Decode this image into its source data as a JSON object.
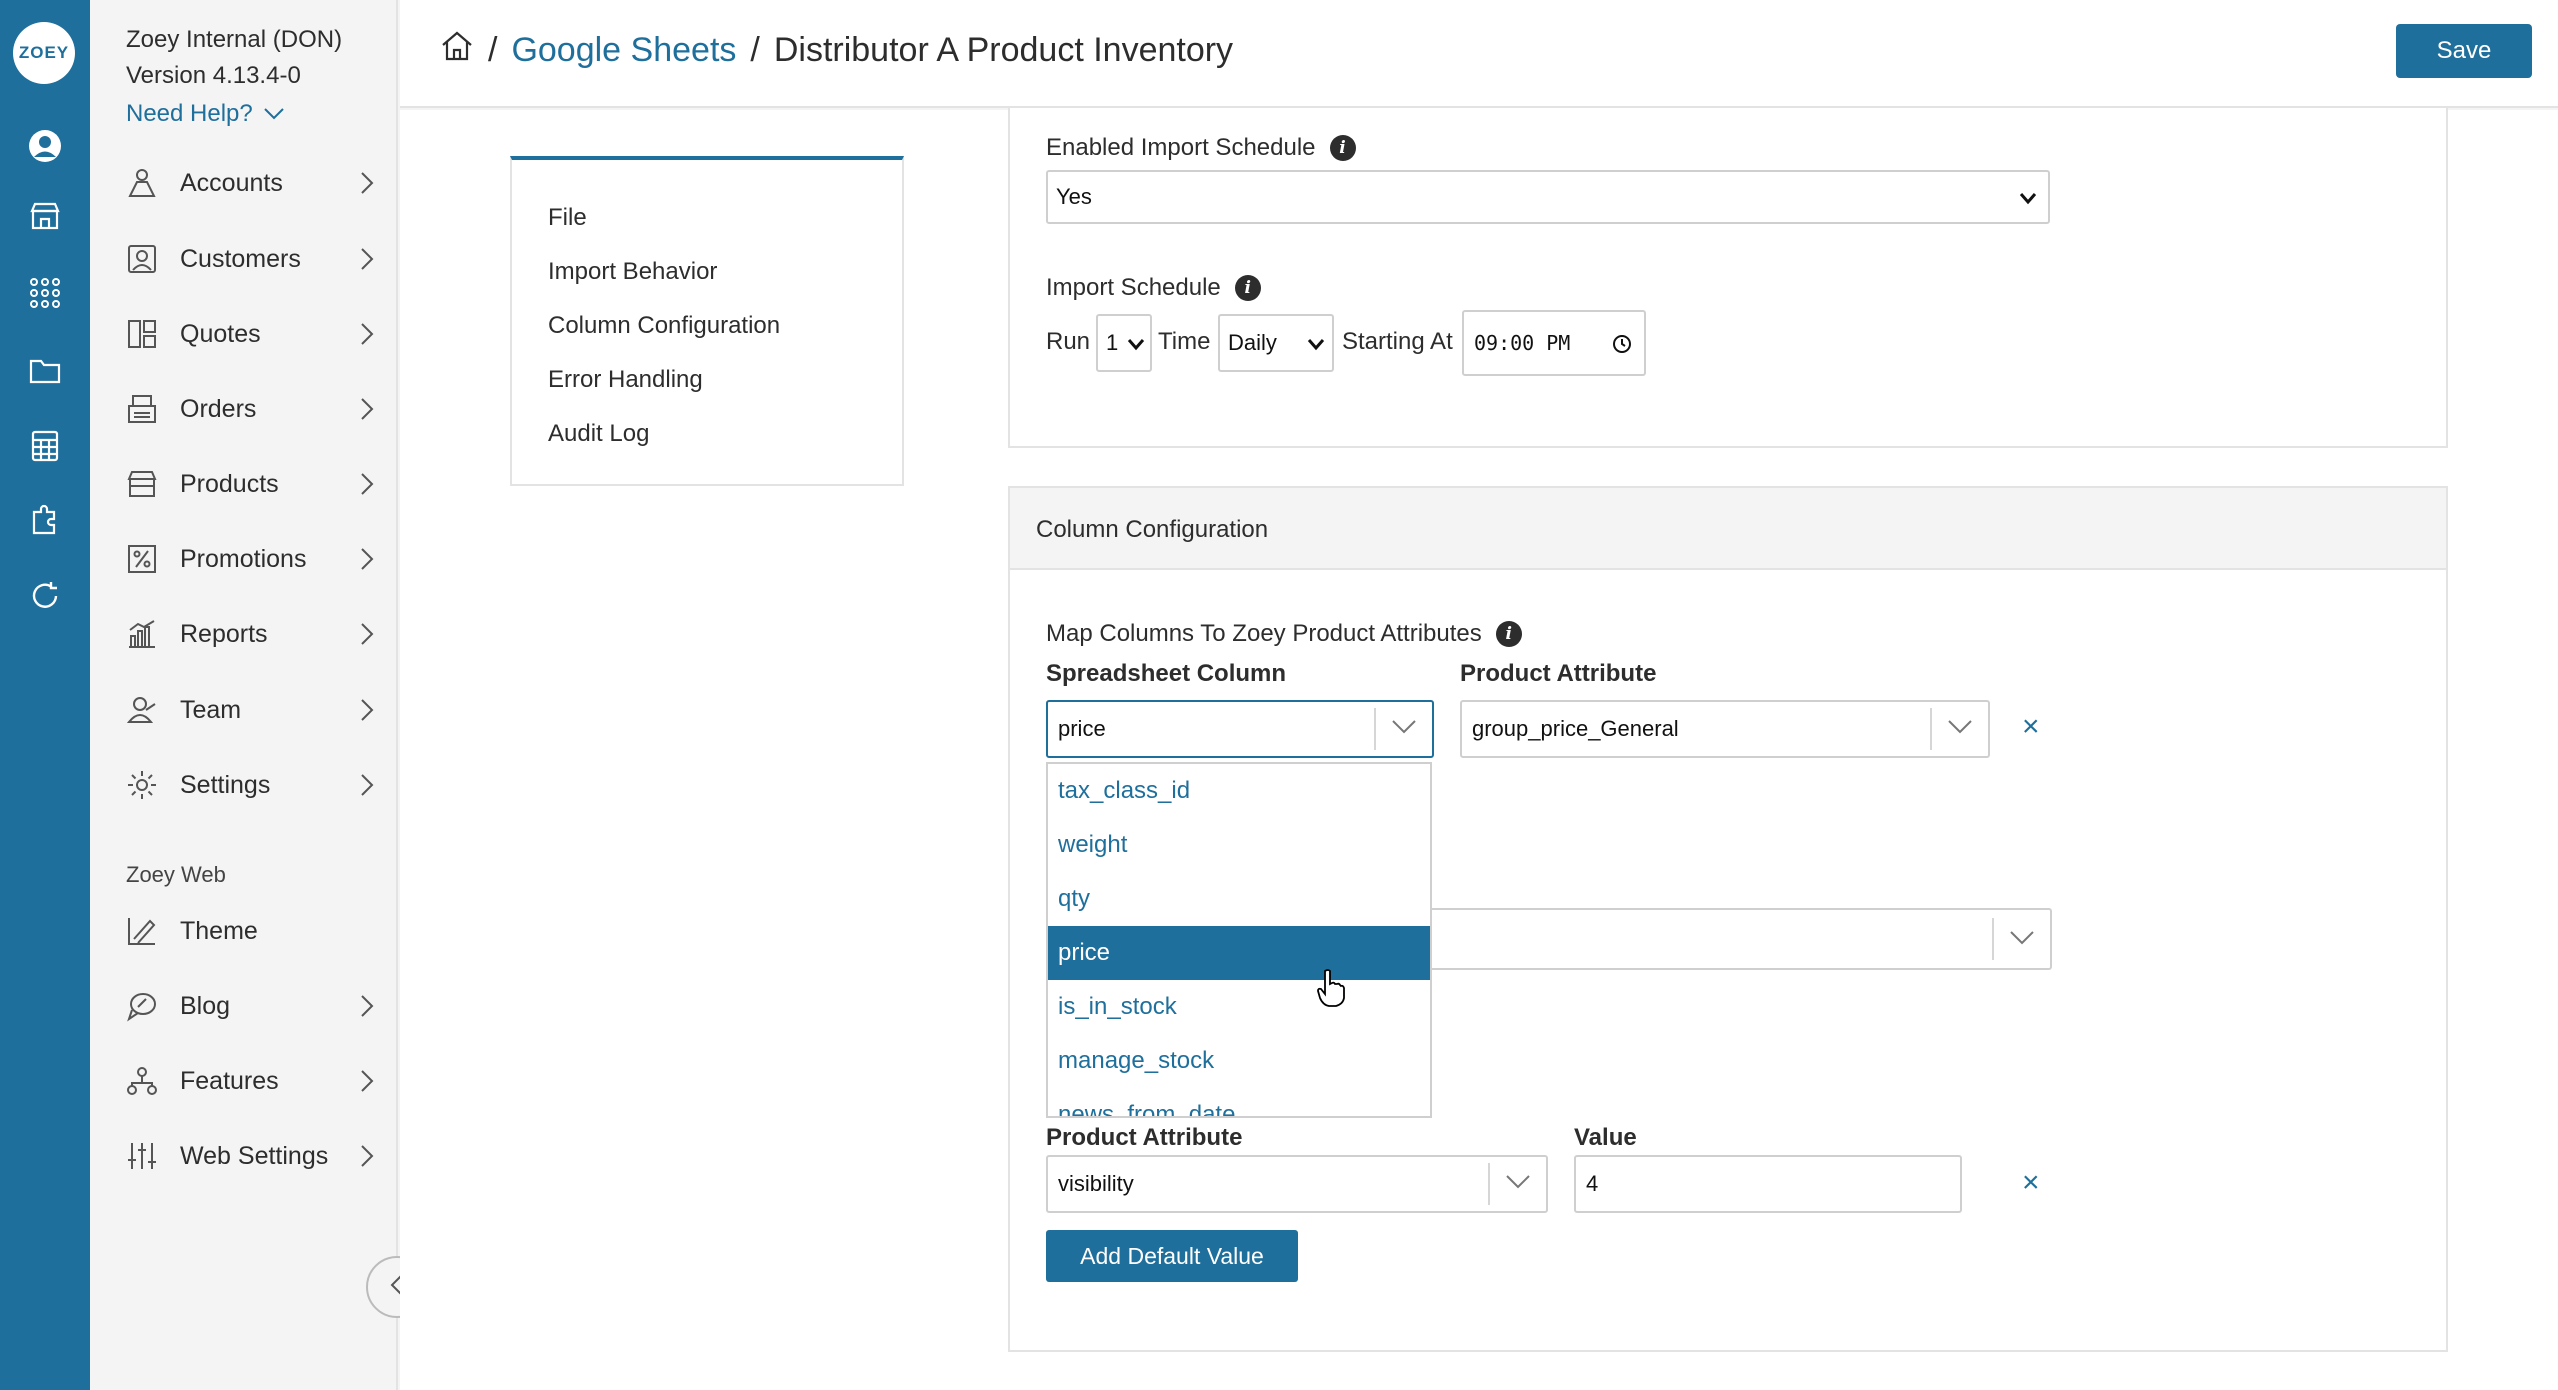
{
  "app": {
    "logo_text": "ZOEY",
    "org_name": "Zoey Internal (DON)",
    "version": "Version 4.13.4-0",
    "help_label": "Need Help?"
  },
  "sidebar": {
    "items": [
      {
        "label": "Accounts",
        "icon": "accounts-icon"
      },
      {
        "label": "Customers",
        "icon": "customers-icon"
      },
      {
        "label": "Quotes",
        "icon": "quotes-icon"
      },
      {
        "label": "Orders",
        "icon": "orders-icon"
      },
      {
        "label": "Products",
        "icon": "products-icon"
      },
      {
        "label": "Promotions",
        "icon": "promotions-icon"
      },
      {
        "label": "Reports",
        "icon": "reports-icon"
      },
      {
        "label": "Team",
        "icon": "team-icon"
      },
      {
        "label": "Settings",
        "icon": "settings-icon"
      }
    ],
    "web_section_label": "Zoey Web",
    "web_items": [
      {
        "label": "Theme",
        "icon": "theme-icon"
      },
      {
        "label": "Blog",
        "icon": "blog-icon"
      },
      {
        "label": "Features",
        "icon": "features-icon"
      },
      {
        "label": "Web Settings",
        "icon": "web-settings-icon"
      }
    ]
  },
  "header": {
    "breadcrumb": {
      "separator": "/",
      "parent": "Google Sheets",
      "current": "Distributor A Product Inventory"
    },
    "save_label": "Save"
  },
  "toc": {
    "items": [
      "File",
      "Import Behavior",
      "Column Configuration",
      "Error Handling",
      "Audit Log"
    ]
  },
  "schedule": {
    "enabled_label": "Enabled Import Schedule",
    "enabled_value": "Yes",
    "schedule_label": "Import Schedule",
    "run_label": "Run",
    "run_value": "1",
    "time_label": "Time",
    "time_value": "Daily",
    "starting_label": "Starting At",
    "starting_value": "09:00 PM"
  },
  "column_config": {
    "title": "Column Configuration",
    "map_label": "Map Columns To Zoey Product Attributes",
    "col_header_spreadsheet": "Spreadsheet Column",
    "col_header_attribute": "Product Attribute",
    "row1_spreadsheet_value": "price",
    "row1_attribute_value": "group_price_General",
    "dropdown_options": [
      "tax_class_id",
      "weight",
      "qty",
      "price",
      "is_in_stock",
      "manage_stock",
      "news_from_date"
    ],
    "dropdown_selected": "price",
    "default_attr_header": "Product Attribute",
    "default_value_header": "Value",
    "default_attr_value": "visibility",
    "default_value_value": "4",
    "add_default_label": "Add Default Value",
    "remove_symbol": "×"
  },
  "colors": {
    "brand": "#1f6f9c"
  }
}
